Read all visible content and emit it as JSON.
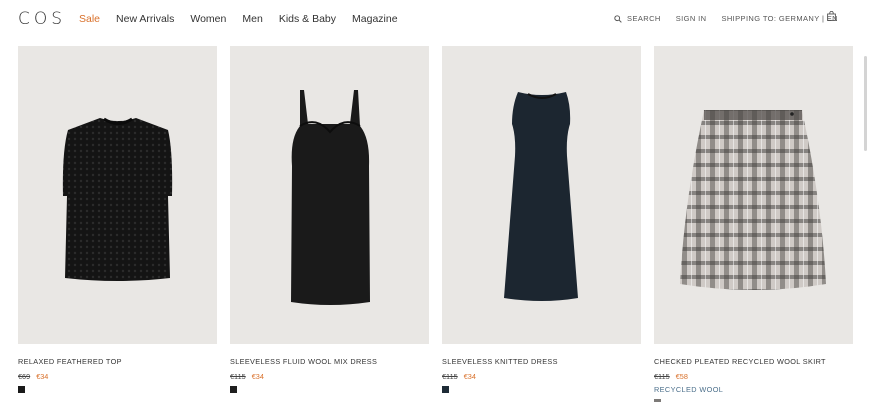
{
  "header": {
    "logo": "COS",
    "nav": [
      "Sale",
      "New Arrivals",
      "Women",
      "Men",
      "Kids & Baby",
      "Magazine"
    ],
    "search_label": "SEARCH",
    "sign_in_label": "SIGN IN",
    "shipping_label": "SHIPPING TO: GERMANY | EN"
  },
  "products": [
    {
      "name": "RELAXED FEATHERED TOP",
      "old_price": "€69",
      "new_price": "€34",
      "swatch": "#1a1a1a"
    },
    {
      "name": "SLEEVELESS FLUID WOOL MIX DRESS",
      "old_price": "€115",
      "new_price": "€34",
      "swatch": "#1f1f1f"
    },
    {
      "name": "SLEEVELESS KNITTED DRESS",
      "old_price": "€115",
      "new_price": "€34",
      "swatch": "#1e2b36"
    },
    {
      "name": "CHECKED PLEATED RECYCLED WOOL SKIRT",
      "old_price": "€115",
      "new_price": "€58",
      "tag": "RECYCLED WOOL",
      "swatch": "#7d7a78"
    }
  ],
  "colors": {
    "accent": "#d9702a",
    "tag": "#4a6e8a",
    "image_bg": "#e9e7e4"
  },
  "icons": [
    "search-icon",
    "shopping-bag-icon"
  ]
}
